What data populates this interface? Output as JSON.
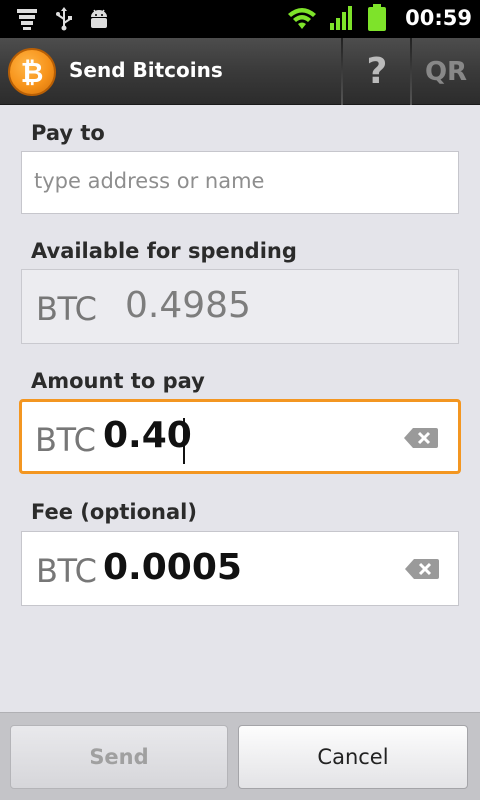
{
  "status_bar": {
    "time": "00:59",
    "icons": [
      "notification-stack-icon",
      "usb-icon",
      "android-debug-icon",
      "wifi-icon",
      "signal-icon",
      "battery-icon"
    ]
  },
  "action_bar": {
    "title": "Send Bitcoins",
    "help_label": "?",
    "qr_label": "QR",
    "logo_glyph": "₿",
    "brand_color": "#f7931a"
  },
  "form": {
    "pay_to": {
      "label": "Pay to",
      "placeholder": "type address or name",
      "value": ""
    },
    "available": {
      "label": "Available for spending",
      "currency": "BTC",
      "value": "0.4985"
    },
    "amount": {
      "label": "Amount to pay",
      "currency": "BTC",
      "value": "0.40",
      "focused": true
    },
    "fee": {
      "label": "Fee (optional)",
      "currency": "BTC",
      "value": "0.0005"
    }
  },
  "buttons": {
    "send": {
      "label": "Send",
      "enabled": false
    },
    "cancel": {
      "label": "Cancel",
      "enabled": true
    }
  },
  "colors": {
    "focus_border": "#f39621",
    "background": "#e4e4ea"
  }
}
